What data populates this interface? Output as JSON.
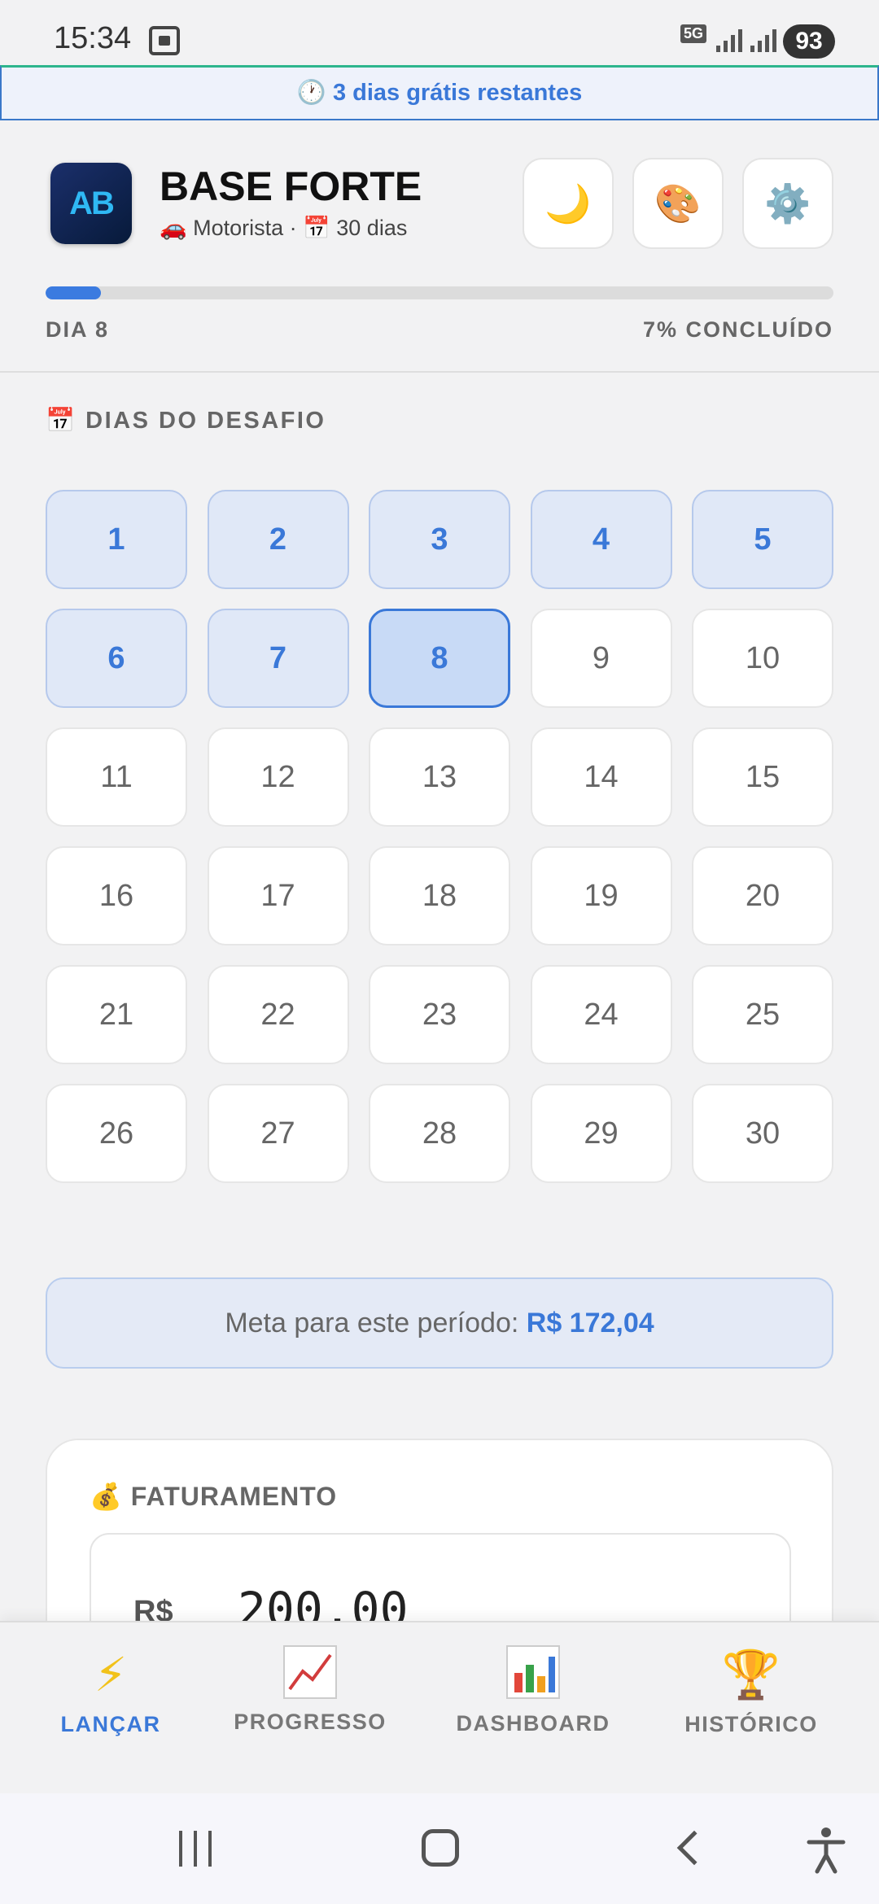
{
  "status_bar": {
    "time": "15:34",
    "network": "5G",
    "battery": "93"
  },
  "trial_banner": {
    "text": "🕐 3 dias grátis restantes"
  },
  "header": {
    "logo_text": "AB",
    "title": "BASE FORTE",
    "subtitle": "🚗 Motorista · 📅 30 dias",
    "buttons": {
      "theme": "🌙",
      "palette": "🎨",
      "settings": "⚙️"
    },
    "progress_percent": 7,
    "day_label": "DIA 8",
    "progress_label": "7% CONCLUÍDO"
  },
  "challenge_days": {
    "title": "📅 DIAS DO DESAFIO",
    "current_day": 8,
    "days": [
      "1",
      "2",
      "3",
      "4",
      "5",
      "6",
      "7",
      "8",
      "9",
      "10",
      "11",
      "12",
      "13",
      "14",
      "15",
      "16",
      "17",
      "18",
      "19",
      "20",
      "21",
      "22",
      "23",
      "24",
      "25",
      "26",
      "27",
      "28",
      "29",
      "30"
    ]
  },
  "goal": {
    "label": "Meta para este período: ",
    "value": "R$ 172,04"
  },
  "revenue": {
    "title": "💰 FATURAMENTO",
    "currency": "R$",
    "value": "200,00"
  },
  "bottom_nav": {
    "items": [
      {
        "label": "LANÇAR",
        "icon": "lightning-icon",
        "active": true
      },
      {
        "label": "PROGRESSO",
        "icon": "chart-increasing-icon",
        "active": false
      },
      {
        "label": "DASHBOARD",
        "icon": "bar-chart-icon",
        "active": false
      },
      {
        "label": "HISTÓRICO",
        "icon": "trophy-icon",
        "active": false
      }
    ]
  },
  "colors": {
    "accent": "#3a78d8",
    "background": "#f2f2f3",
    "done_day_bg": "#e0e8f7",
    "current_day_bg": "#c8daf6"
  }
}
